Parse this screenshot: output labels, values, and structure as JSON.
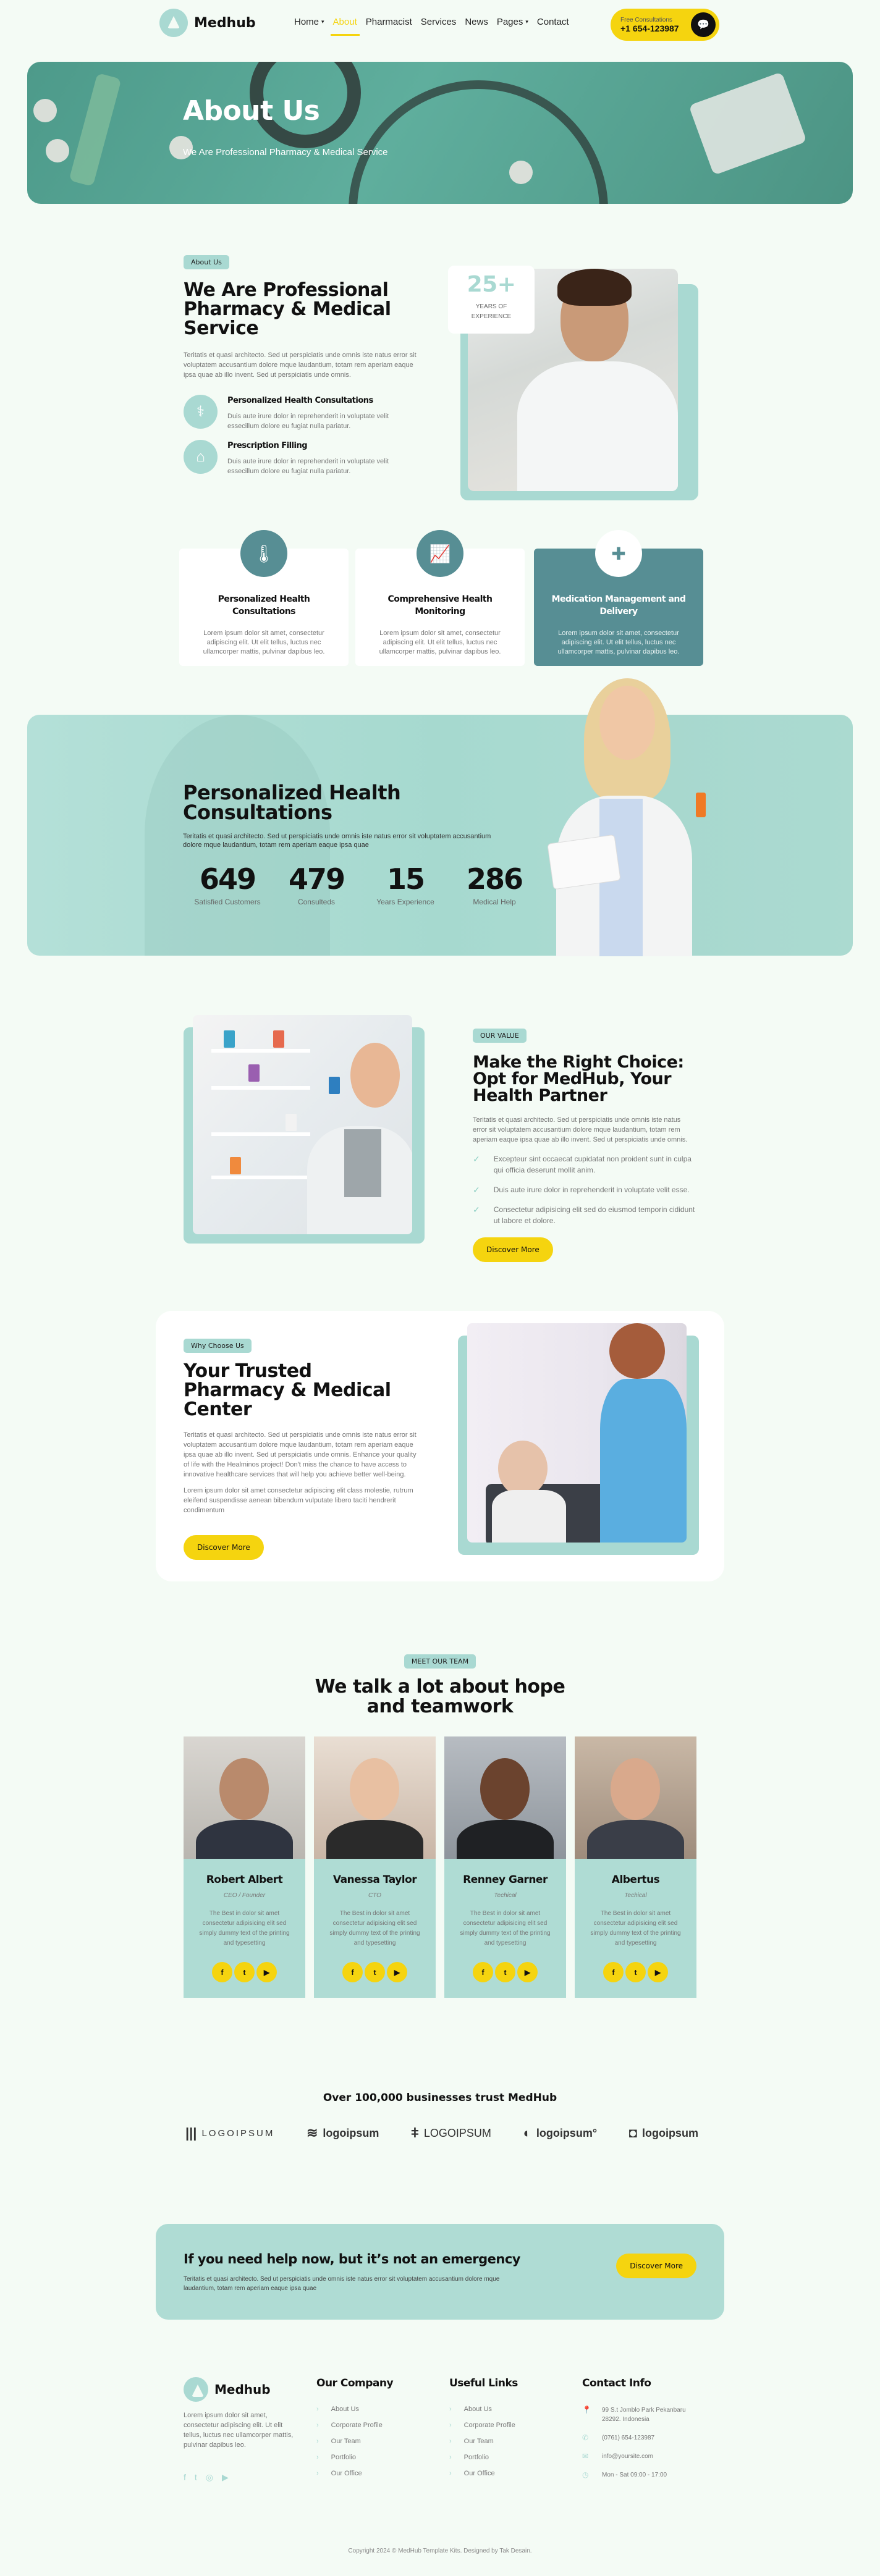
{
  "header": {
    "brand": "Medhub",
    "nav": [
      {
        "label": "Home",
        "has_dropdown": true,
        "active": false
      },
      {
        "label": "About",
        "has_dropdown": false,
        "active": true
      },
      {
        "label": "Pharmacist",
        "has_dropdown": false,
        "active": false
      },
      {
        "label": "Services",
        "has_dropdown": false,
        "active": false
      },
      {
        "label": "News",
        "has_dropdown": false,
        "active": false
      },
      {
        "label": "Pages",
        "has_dropdown": true,
        "active": false
      },
      {
        "label": "Contact",
        "has_dropdown": false,
        "active": false
      }
    ],
    "cta": {
      "caption": "Free Consultations",
      "phone": "+1 654-123987",
      "icon": "chat-bubbles-icon"
    }
  },
  "hero": {
    "title": "About Us",
    "subtitle": "We Are Professional Pharmacy & Medical Service"
  },
  "about": {
    "badge": "About Us",
    "title": "We Are Professional Pharmacy & Medical Service",
    "body": "Teritatis et quasi architecto. Sed ut perspiciatis unde omnis iste natus error sit voluptatem accusantium dolore mque laudantium, totam rem aperiam eaque ipsa quae ab illo invent. Sed ut perspiciatis unde omnis.",
    "features": [
      {
        "icon": "stethoscope-icon",
        "title": "Personalized Health Consultations",
        "text": "Duis aute irure dolor in reprehenderit in voluptate velit essecillum dolore eu fugiat nulla pariatur."
      },
      {
        "icon": "house-medical-icon",
        "title": "Prescription Filling",
        "text": "Duis aute irure dolor in reprehenderit in voluptate velit essecillum dolore eu fugiat nulla pariatur."
      }
    ],
    "experience": {
      "number": "25+",
      "label": "YEARS OF EXPERIENCE"
    }
  },
  "services": [
    {
      "icon": "thermometer-icon",
      "title": "Personalized Health Consultations",
      "text": "Lorem ipsum dolor sit amet, consectetur adipiscing elit. Ut elit tellus, luctus nec ullamcorper mattis, pulvinar dapibus leo.",
      "highlighted": false
    },
    {
      "icon": "chart-line-icon",
      "title": "Comprehensive Health Monitoring",
      "text": "Lorem ipsum dolor sit amet, consectetur adipiscing elit. Ut elit tellus, luctus nec ullamcorper mattis, pulvinar dapibus leo.",
      "highlighted": false
    },
    {
      "icon": "first-aid-kit-icon",
      "title": "Medication Management and Delivery",
      "text": "Lorem ipsum dolor sit amet, consectetur adipiscing elit. Ut elit tellus, luctus nec ullamcorper mattis, pulvinar dapibus leo.",
      "highlighted": true
    }
  ],
  "stats_banner": {
    "title": "Personalized Health Consultations",
    "body": "Teritatis et quasi architecto. Sed ut perspiciatis unde omnis iste natus error sit voluptatem accusantium dolore mque laudantium, totam rem aperiam eaque ipsa quae",
    "stats": [
      {
        "value": "649",
        "label": "Satisfied Customers"
      },
      {
        "value": "479",
        "label": "Consulteds"
      },
      {
        "value": "15",
        "label": "Years Experience"
      },
      {
        "value": "286",
        "label": "Medical Help"
      }
    ]
  },
  "value": {
    "badge": "OUR VALUE",
    "title": "Make the Right Choice: Opt for MedHub, Your Health Partner",
    "body": "Teritatis et quasi architecto. Sed ut perspiciatis unde omnis iste natus error sit voluptatem accusantium dolore mque laudantium, totam rem aperiam eaque ipsa quae ab illo invent. Sed ut perspiciatis unde omnis.",
    "checks": [
      "Excepteur sint occaecat cupidatat non proident sunt in culpa qui officia deserunt mollit anim.",
      "Duis aute irure dolor in reprehenderit in voluptate velit esse.",
      "Consectetur adipisicing elit sed do eiusmod temporin cididunt ut labore et dolore."
    ],
    "button": "Discover More"
  },
  "why": {
    "badge": "Why Choose Us",
    "title": "Your Trusted Pharmacy & Medical Center",
    "body1": "Teritatis et quasi architecto. Sed ut perspiciatis unde omnis iste natus error sit voluptatem accusantium dolore mque laudantium, totam rem aperiam eaque ipsa quae ab illo invent. Sed ut perspiciatis unde omnis. Enhance your quality of life with the Healminos project! Don't miss the chance to have access to innovative healthcare services that will help you achieve better well-being.",
    "body2": "Lorem ipsum dolor sit amet consectetur adipiscing elit class molestie, rutrum eleifend suspendisse aenean bibendum vulputate libero taciti hendrerit condimentum",
    "button": "Discover More"
  },
  "team": {
    "badge": "MEET OUR TEAM",
    "title": "We talk a lot about hope and teamwork",
    "members": [
      {
        "name": "Robert Albert",
        "role": "CEO / Founder",
        "bio": "The Best in dolor sit amet consectetur adipisicing elit sed simply dummy text of the printing and typesetting"
      },
      {
        "name": "Vanessa Taylor",
        "role": "CTO",
        "bio": "The Best in dolor sit amet consectetur adipisicing elit sed simply dummy text of the printing and typesetting"
      },
      {
        "name": "Renney Garner",
        "role": "Techical",
        "bio": "The Best in dolor sit amet consectetur adipisicing elit sed simply dummy text of the printing and typesetting"
      },
      {
        "name": "Albertus",
        "role": "Techical",
        "bio": "The Best in dolor sit amet consectetur adipisicing elit sed simply dummy text of the printing and typesetting"
      }
    ],
    "social": [
      "f",
      "t",
      "▶"
    ]
  },
  "trust": {
    "title": "Over 100,000 businesses trust MedHub",
    "logos": [
      {
        "symbol": "|||",
        "text": "LOGOIPSUM"
      },
      {
        "symbol": "≋",
        "text": "logoipsum"
      },
      {
        "symbol": "ǂ",
        "text": "LOGOIPSUM"
      },
      {
        "symbol": "◐",
        "text": "logoipsum°"
      },
      {
        "symbol": "◘",
        "text": "logoipsum"
      }
    ]
  },
  "help": {
    "title": "If you need help now, but it’s not an emergency",
    "body": "Teritatis et quasi architecto. Sed ut perspiciatis unde omnis iste natus error sit voluptatem accusantium dolore mque laudantium, totam rem aperiam eaque ipsa quae",
    "button": "Discover More"
  },
  "footer": {
    "brand": "Medhub",
    "about": "Lorem ipsum dolor sit amet, consectetur adipiscing elit. Ut elit tellus, luctus nec ullamcorper mattis, pulvinar dapibus leo.",
    "social": [
      "f",
      "t",
      "◎",
      "▶"
    ],
    "company": {
      "title": "Our Company",
      "links": [
        "About Us",
        "Corporate Profile",
        "Our Team",
        "Portfolio",
        "Our Office"
      ]
    },
    "useful": {
      "title": "Useful Links",
      "links": [
        "About Us",
        "Corporate Profile",
        "Our Team",
        "Portfolio",
        "Our Office"
      ]
    },
    "contact": {
      "title": "Contact Info",
      "address": "99 S.t Jomblo Park Pekanbaru 28292. Indonesia",
      "phone": "(0761) 654-123987",
      "email": "info@yoursite.com",
      "hours": "Mon - Sat 09:00 - 17:00"
    },
    "copyright": "Copyright 2024 © MedHub Template Kits. Designed by Tak Desain."
  },
  "colors": {
    "accent": "#f5d40f",
    "mint": "#a9d9d2",
    "teal": "#578e94",
    "background": "#f4fbf5"
  }
}
